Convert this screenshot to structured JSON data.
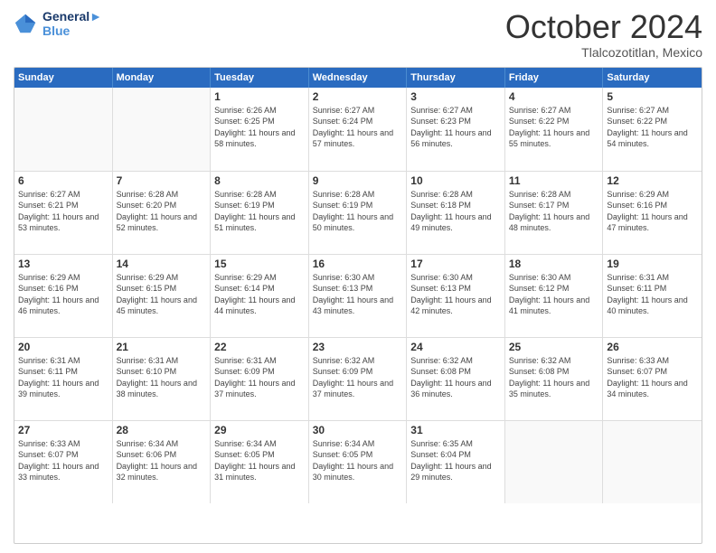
{
  "header": {
    "logo_line1": "General",
    "logo_line2": "Blue",
    "month": "October 2024",
    "location": "Tlalcozotitlan, Mexico"
  },
  "days_of_week": [
    "Sunday",
    "Monday",
    "Tuesday",
    "Wednesday",
    "Thursday",
    "Friday",
    "Saturday"
  ],
  "weeks": [
    [
      {
        "day": "",
        "info": ""
      },
      {
        "day": "",
        "info": ""
      },
      {
        "day": "1",
        "info": "Sunrise: 6:26 AM\nSunset: 6:25 PM\nDaylight: 11 hours and 58 minutes."
      },
      {
        "day": "2",
        "info": "Sunrise: 6:27 AM\nSunset: 6:24 PM\nDaylight: 11 hours and 57 minutes."
      },
      {
        "day": "3",
        "info": "Sunrise: 6:27 AM\nSunset: 6:23 PM\nDaylight: 11 hours and 56 minutes."
      },
      {
        "day": "4",
        "info": "Sunrise: 6:27 AM\nSunset: 6:22 PM\nDaylight: 11 hours and 55 minutes."
      },
      {
        "day": "5",
        "info": "Sunrise: 6:27 AM\nSunset: 6:22 PM\nDaylight: 11 hours and 54 minutes."
      }
    ],
    [
      {
        "day": "6",
        "info": "Sunrise: 6:27 AM\nSunset: 6:21 PM\nDaylight: 11 hours and 53 minutes."
      },
      {
        "day": "7",
        "info": "Sunrise: 6:28 AM\nSunset: 6:20 PM\nDaylight: 11 hours and 52 minutes."
      },
      {
        "day": "8",
        "info": "Sunrise: 6:28 AM\nSunset: 6:19 PM\nDaylight: 11 hours and 51 minutes."
      },
      {
        "day": "9",
        "info": "Sunrise: 6:28 AM\nSunset: 6:19 PM\nDaylight: 11 hours and 50 minutes."
      },
      {
        "day": "10",
        "info": "Sunrise: 6:28 AM\nSunset: 6:18 PM\nDaylight: 11 hours and 49 minutes."
      },
      {
        "day": "11",
        "info": "Sunrise: 6:28 AM\nSunset: 6:17 PM\nDaylight: 11 hours and 48 minutes."
      },
      {
        "day": "12",
        "info": "Sunrise: 6:29 AM\nSunset: 6:16 PM\nDaylight: 11 hours and 47 minutes."
      }
    ],
    [
      {
        "day": "13",
        "info": "Sunrise: 6:29 AM\nSunset: 6:16 PM\nDaylight: 11 hours and 46 minutes."
      },
      {
        "day": "14",
        "info": "Sunrise: 6:29 AM\nSunset: 6:15 PM\nDaylight: 11 hours and 45 minutes."
      },
      {
        "day": "15",
        "info": "Sunrise: 6:29 AM\nSunset: 6:14 PM\nDaylight: 11 hours and 44 minutes."
      },
      {
        "day": "16",
        "info": "Sunrise: 6:30 AM\nSunset: 6:13 PM\nDaylight: 11 hours and 43 minutes."
      },
      {
        "day": "17",
        "info": "Sunrise: 6:30 AM\nSunset: 6:13 PM\nDaylight: 11 hours and 42 minutes."
      },
      {
        "day": "18",
        "info": "Sunrise: 6:30 AM\nSunset: 6:12 PM\nDaylight: 11 hours and 41 minutes."
      },
      {
        "day": "19",
        "info": "Sunrise: 6:31 AM\nSunset: 6:11 PM\nDaylight: 11 hours and 40 minutes."
      }
    ],
    [
      {
        "day": "20",
        "info": "Sunrise: 6:31 AM\nSunset: 6:11 PM\nDaylight: 11 hours and 39 minutes."
      },
      {
        "day": "21",
        "info": "Sunrise: 6:31 AM\nSunset: 6:10 PM\nDaylight: 11 hours and 38 minutes."
      },
      {
        "day": "22",
        "info": "Sunrise: 6:31 AM\nSunset: 6:09 PM\nDaylight: 11 hours and 37 minutes."
      },
      {
        "day": "23",
        "info": "Sunrise: 6:32 AM\nSunset: 6:09 PM\nDaylight: 11 hours and 37 minutes."
      },
      {
        "day": "24",
        "info": "Sunrise: 6:32 AM\nSunset: 6:08 PM\nDaylight: 11 hours and 36 minutes."
      },
      {
        "day": "25",
        "info": "Sunrise: 6:32 AM\nSunset: 6:08 PM\nDaylight: 11 hours and 35 minutes."
      },
      {
        "day": "26",
        "info": "Sunrise: 6:33 AM\nSunset: 6:07 PM\nDaylight: 11 hours and 34 minutes."
      }
    ],
    [
      {
        "day": "27",
        "info": "Sunrise: 6:33 AM\nSunset: 6:07 PM\nDaylight: 11 hours and 33 minutes."
      },
      {
        "day": "28",
        "info": "Sunrise: 6:34 AM\nSunset: 6:06 PM\nDaylight: 11 hours and 32 minutes."
      },
      {
        "day": "29",
        "info": "Sunrise: 6:34 AM\nSunset: 6:05 PM\nDaylight: 11 hours and 31 minutes."
      },
      {
        "day": "30",
        "info": "Sunrise: 6:34 AM\nSunset: 6:05 PM\nDaylight: 11 hours and 30 minutes."
      },
      {
        "day": "31",
        "info": "Sunrise: 6:35 AM\nSunset: 6:04 PM\nDaylight: 11 hours and 29 minutes."
      },
      {
        "day": "",
        "info": ""
      },
      {
        "day": "",
        "info": ""
      }
    ]
  ]
}
